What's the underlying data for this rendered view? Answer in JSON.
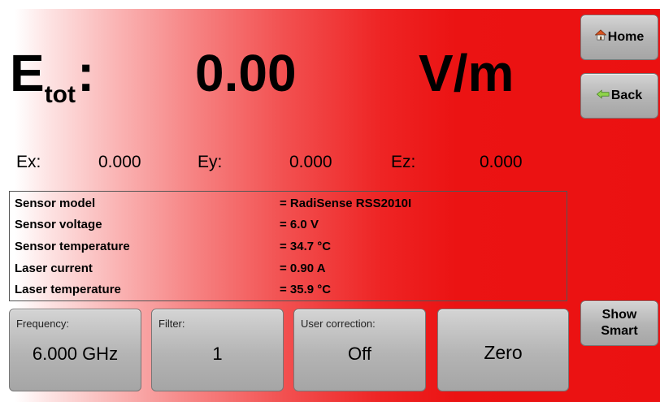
{
  "header": {
    "quantity_main": "E",
    "quantity_sub": "tot",
    "quantity_colon": ":",
    "value": "0.00",
    "unit": "V/m"
  },
  "components": {
    "ex_label": "Ex:",
    "ex_value": "0.000",
    "ey_label": "Ey:",
    "ey_value": "0.000",
    "ez_label": "Ez:",
    "ez_value": "0.000"
  },
  "info": {
    "rows": [
      {
        "label": "Sensor model",
        "value": "= RadiSense RSS2010I"
      },
      {
        "label": "Sensor voltage",
        "value": "= 6.0 V"
      },
      {
        "label": "Sensor temperature",
        "value": "= 34.7 °C"
      },
      {
        "label": "Laser current",
        "value": "= 0.90 A"
      },
      {
        "label": "Laser temperature",
        "value": "= 35.9  °C"
      }
    ]
  },
  "buttons": {
    "frequency": {
      "caption": "Frequency:",
      "value": "6.000 GHz"
    },
    "filter": {
      "caption": "Filter:",
      "value": "1"
    },
    "user_correction": {
      "caption": "User correction:",
      "value": "Off"
    },
    "zero": {
      "value": "Zero"
    }
  },
  "side": {
    "home": {
      "label": "Home",
      "icon": "house-icon"
    },
    "back": {
      "label": "Back",
      "icon": "arrow-left-icon"
    },
    "show_smart": {
      "label_line1": "Show",
      "label_line2": "Smart"
    }
  },
  "colors": {
    "accent_red": "#eb1313",
    "button_gray": "#b4b4b4",
    "back_arrow": "#8fd34a",
    "home_roof": "#d9531e"
  }
}
